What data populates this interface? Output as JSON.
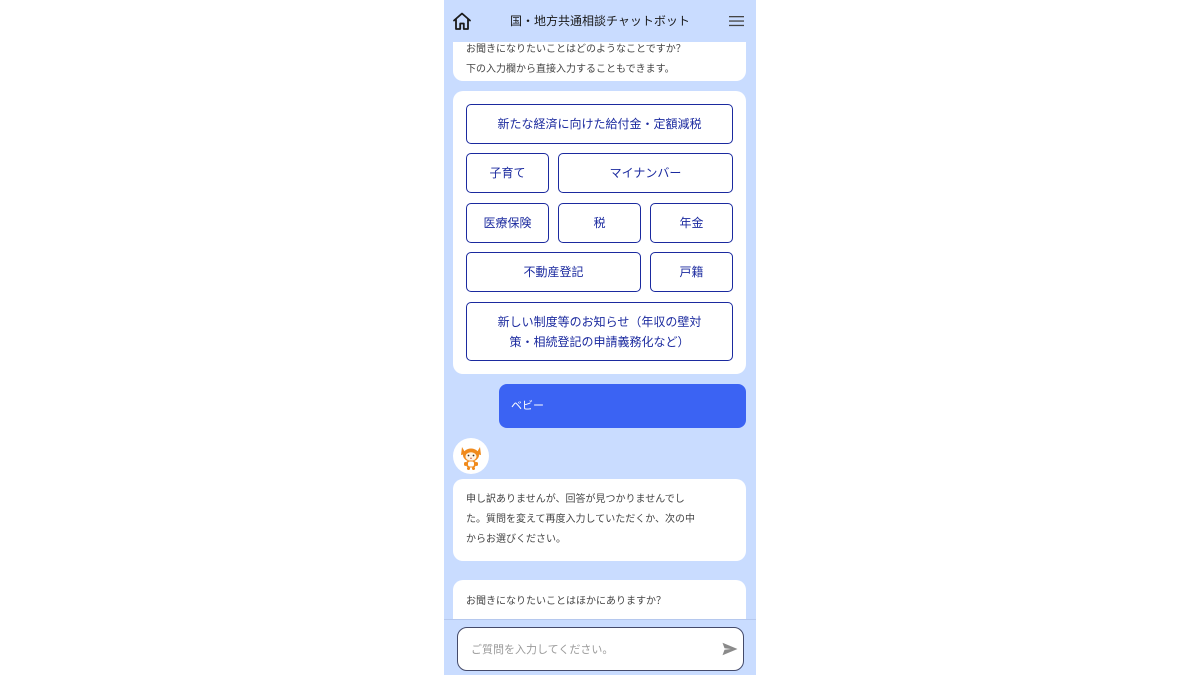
{
  "header": {
    "title": "国・地方共通相談チャットボット",
    "home_icon": "home-icon",
    "menu_icon": "hamburger-menu-icon"
  },
  "chat": {
    "prev_bot_message": {
      "line1": "お聞きになりたいことはどのようなことですか？",
      "line2": "下の入力欄から直接入力することもできます。"
    },
    "choices": {
      "c1": "新たな経済に向けた給付金・定額減税",
      "c2": "子育て",
      "c3": "マイナンバー",
      "c4": "医療保険",
      "c5": "税",
      "c6": "年金",
      "c7": "不動産登記",
      "c8": "戸籍",
      "c9_line1": "新しい制度等のお知らせ（年収の壁対",
      "c9_line2": "策・相続登記の申請義務化など）"
    },
    "user_message": "ベビー",
    "bot_avatar": "mascot-avatar-icon",
    "bot_reply": {
      "line1": "申し訳ありませんが、回答が見つかりませんでし",
      "line2": "た。質問を変えて再度入力していただくか、次の中",
      "line3": "からお選びください。"
    },
    "followup": "お聞きになりたいことはほかにありますか？"
  },
  "input": {
    "placeholder": "ご質問を入力してください。",
    "send_icon": "send-icon"
  },
  "colors": {
    "background": "#c9dcff",
    "choice_border": "#1b2a9f",
    "user_bubble": "#3b63f3",
    "bubble": "#ffffff"
  }
}
